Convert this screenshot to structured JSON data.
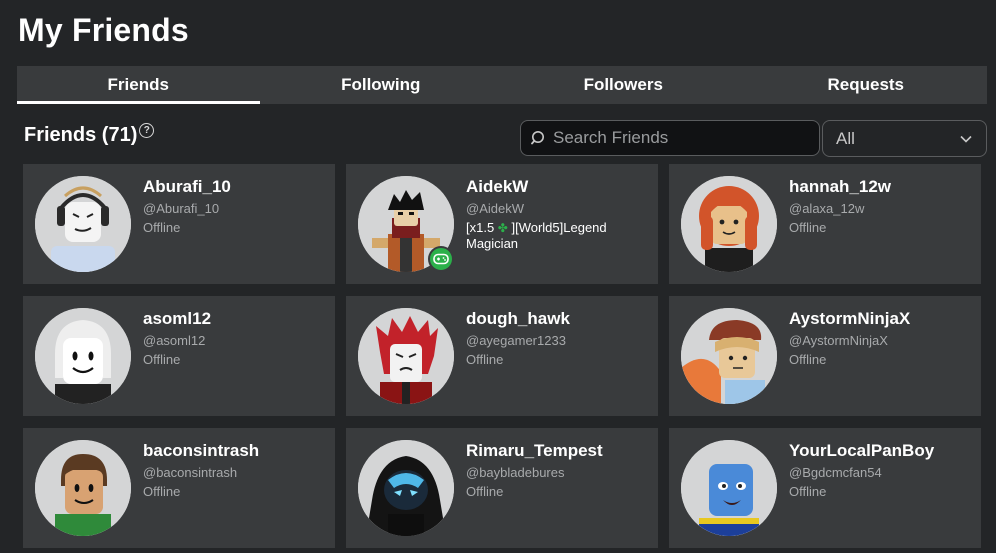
{
  "page_title": "My Friends",
  "tabs": [
    {
      "label": "Friends",
      "active": true
    },
    {
      "label": "Following",
      "active": false
    },
    {
      "label": "Followers",
      "active": false
    },
    {
      "label": "Requests",
      "active": false
    }
  ],
  "section": {
    "title": "Friends (71)",
    "help_icon": "question-circle-icon"
  },
  "search": {
    "placeholder": "Search Friends",
    "value": "",
    "icon": "search-icon"
  },
  "filter": {
    "selected": "All",
    "icon": "chevron-down-icon"
  },
  "friends": [
    {
      "name": "Aburafi_10",
      "handle": "@Aburafi_10",
      "status": "Offline"
    },
    {
      "name": "AidekW",
      "handle": "@AidekW",
      "status_prefix": "[x1.5 ",
      "status_icon": "clover-icon",
      "status_suffix": " ][World5]Legend Magician",
      "in_game": true
    },
    {
      "name": "hannah_12w",
      "handle": "@alaxa_12w",
      "status": "Offline"
    },
    {
      "name": "asoml12",
      "handle": "@asoml12",
      "status": "Offline"
    },
    {
      "name": "dough_hawk",
      "handle": "@ayegamer1233",
      "status": "Offline"
    },
    {
      "name": "AystormNinjaX",
      "handle": "@AystormNinjaX",
      "status": "Offline"
    },
    {
      "name": "baconsintrash",
      "handle": "@baconsintrash",
      "status": "Offline"
    },
    {
      "name": "Rimaru_Tempest",
      "handle": "@baybladebures",
      "status": "Offline"
    },
    {
      "name": "YourLocalPanBoy",
      "handle": "@Bgdcmcfan54",
      "status": "Offline"
    }
  ],
  "colors": {
    "background": "#232527",
    "card": "#393b3d",
    "muted_text": "#a8aaac",
    "in_game_green": "#2bb04a"
  }
}
